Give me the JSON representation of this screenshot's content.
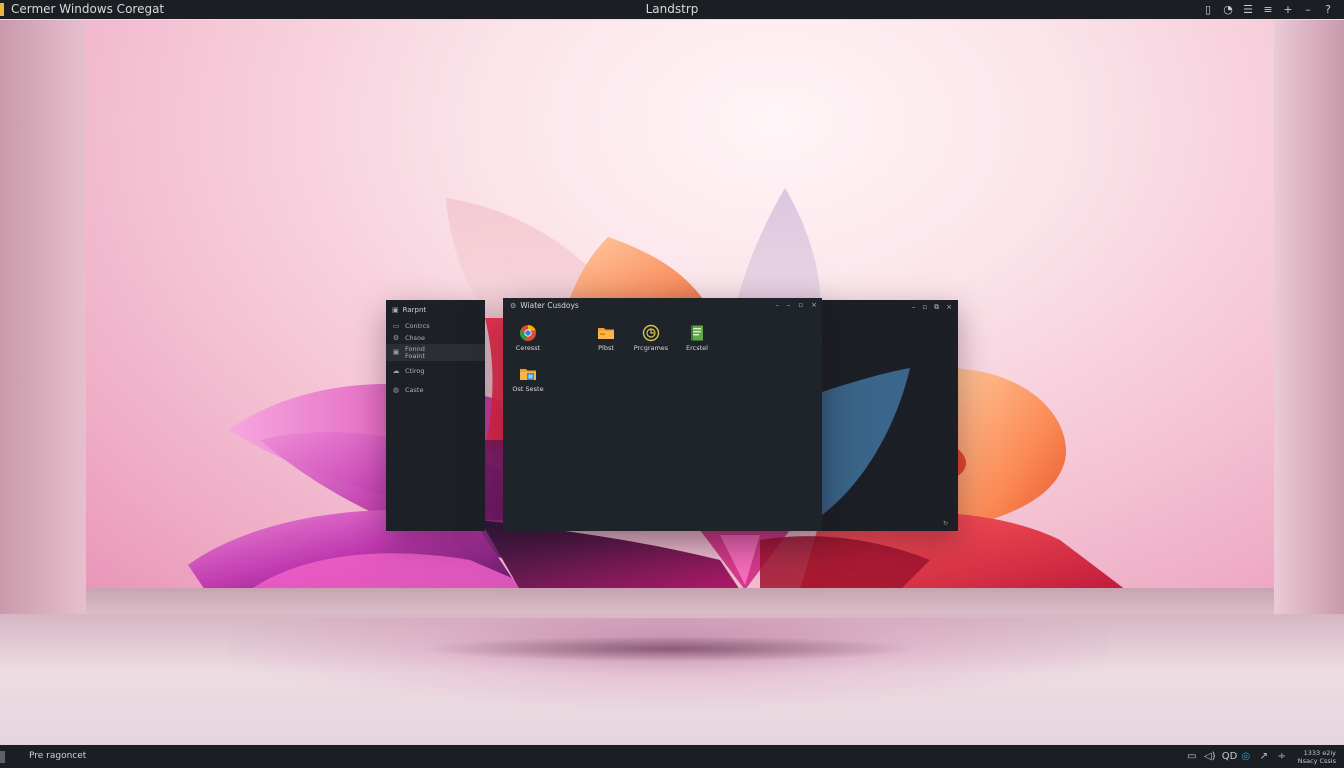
{
  "top_bar": {
    "app_title": "Cermer Windows Coregat",
    "center_title": "Landstrp",
    "tray_icons": [
      "panel-icon",
      "bell-icon",
      "menu-lines-icon",
      "list-icon",
      "plus-icon",
      "minus-icon",
      "question-icon"
    ],
    "tray_glyphs": [
      "▯",
      "◔",
      "☰",
      "≡",
      "+",
      "–",
      "?"
    ]
  },
  "left_window": {
    "title": "Rarpnt",
    "items": [
      {
        "icon": "drive-icon",
        "glyph": "▭",
        "label": "Contrcs"
      },
      {
        "icon": "gear-icon",
        "glyph": "⚙",
        "label": "Chsoe"
      },
      {
        "icon": "folder-icon",
        "glyph": "▣",
        "label": "Fonnd\nFoaint",
        "selected": true
      },
      {
        "icon": "cloud-icon",
        "glyph": "☁",
        "label": "Ctirog"
      },
      {
        "icon": "globe-icon",
        "glyph": "◍",
        "label": "Caste"
      }
    ]
  },
  "main_window": {
    "title": "Wiater Cusdoys",
    "controls": [
      "–",
      "–",
      "▫",
      "×"
    ],
    "icons": [
      {
        "name": "browser-icon",
        "label": "Ceresst"
      },
      {
        "name": "files-folder-icon",
        "label": "Plbst"
      },
      {
        "name": "programs-icon",
        "label": "Prcgrames"
      },
      {
        "name": "notebook-icon",
        "label": "Ercstel"
      },
      {
        "name": "data-folder-icon",
        "label": "Ost Seste"
      }
    ]
  },
  "right_window": {
    "controls": [
      "–",
      "▫",
      "⧉",
      "×"
    ],
    "corner": "↻"
  },
  "taskbar": {
    "status": "Pre ragoncet",
    "tray_glyphs": [
      "▭",
      "◁)",
      "QD",
      "◎",
      "↗",
      "÷"
    ],
    "tray_icons": [
      "keyboard-icon",
      "volume-icon",
      "people-icon",
      "edge-icon",
      "pen-icon",
      "network-icon"
    ],
    "clock_line1": "1333 e2iy",
    "clock_line2": "Nsacy Cssis"
  },
  "colors": {
    "bar_background": "#1b1e23",
    "window_background": "#1f232a",
    "accent_yellow": "#e8b63c",
    "accent_blue": "#1e88e5"
  }
}
